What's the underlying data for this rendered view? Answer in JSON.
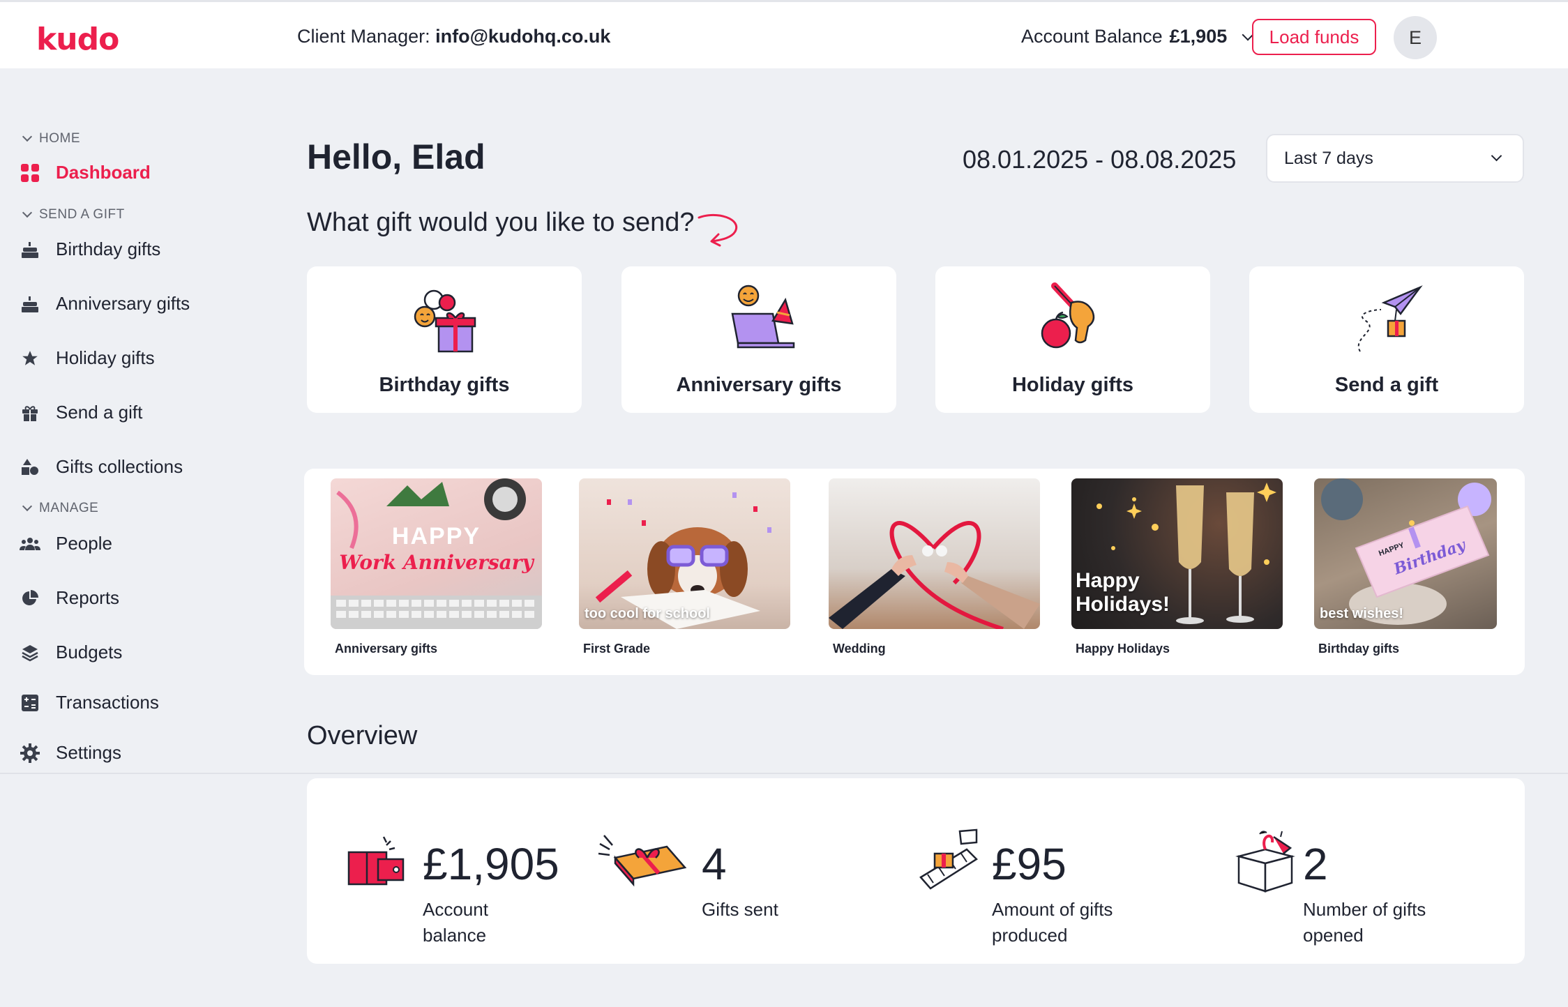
{
  "brand": {
    "logo": "kudo",
    "accent": "#ec1f4d"
  },
  "header": {
    "client_manager_label": "Client Manager:",
    "client_manager_email": "info@kudohq.co.uk",
    "balance_label": "Account Balance",
    "balance_value": "£1,905",
    "load_funds": "Load funds",
    "avatar_initial": "E"
  },
  "sidebar": {
    "home_section": "HOME",
    "dashboard": "Dashboard",
    "send_section": "SEND A GIFT",
    "send_items": [
      {
        "label": "Birthday gifts",
        "icon": "cake-icon"
      },
      {
        "label": "Anniversary gifts",
        "icon": "cake-icon"
      },
      {
        "label": "Holiday gifts",
        "icon": "star-icon"
      },
      {
        "label": "Send a gift",
        "icon": "gift-icon"
      },
      {
        "label": "Gifts collections",
        "icon": "shapes-icon"
      }
    ],
    "manage_section": "MANAGE",
    "manage_items": [
      {
        "label": "People",
        "icon": "people-icon"
      },
      {
        "label": "Reports",
        "icon": "pie-chart-icon"
      },
      {
        "label": "Budgets",
        "icon": "layers-icon"
      },
      {
        "label": "Transactions",
        "icon": "calculator-icon"
      },
      {
        "label": "Settings",
        "icon": "gear-icon"
      }
    ]
  },
  "main": {
    "greeting": "Hello, Elad",
    "date_range": "08.01.2025 - 08.08.2025",
    "period_select": "Last 7 days",
    "question": "What gift would you like to send?",
    "gift_types": [
      {
        "label": "Birthday gifts"
      },
      {
        "label": "Anniversary gifts"
      },
      {
        "label": "Holiday gifts"
      },
      {
        "label": "Send a gift"
      }
    ],
    "collections": [
      {
        "caption": "Anniversary gifts",
        "overlay_line1": "HAPPY",
        "overlay_line2": "Work Anniversary"
      },
      {
        "caption": "First Grade",
        "overlay": "too cool for school"
      },
      {
        "caption": "Wedding"
      },
      {
        "caption": "Happy Holidays",
        "overlay_line1": "Happy",
        "overlay_line2": "Holidays!"
      },
      {
        "caption": "Birthday gifts",
        "overlay": "best wishes!",
        "card_line1": "HAPPY",
        "card_line2": "Birthday"
      }
    ],
    "overview_title": "Overview",
    "stats": [
      {
        "value": "£1,905",
        "desc_line1": "Account",
        "desc_line2": "balance"
      },
      {
        "value": "4",
        "desc_line1": "Gifts sent",
        "desc_line2": ""
      },
      {
        "value": "£95",
        "desc_line1": "Amount of gifts",
        "desc_line2": "produced"
      },
      {
        "value": "2",
        "desc_line1": "Number of gifts",
        "desc_line2": "opened"
      }
    ]
  }
}
